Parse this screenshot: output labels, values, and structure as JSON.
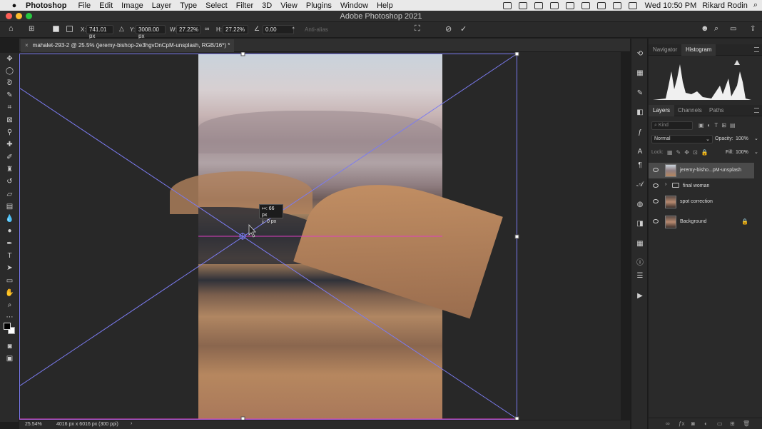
{
  "menubar": {
    "app_name": "Photoshop",
    "items": [
      "File",
      "Edit",
      "Image",
      "Layer",
      "Type",
      "Select",
      "Filter",
      "3D",
      "View",
      "Plugins",
      "Window",
      "Help"
    ],
    "clock": "Wed 10:50 PM",
    "user": "Rikard Rodin"
  },
  "window": {
    "title": "Adobe Photoshop 2021"
  },
  "options": {
    "x_label": "X:",
    "x_value": "741.01 px",
    "y_label": "Y:",
    "y_value": "3008.00 px",
    "w_label": "W:",
    "w_value": "27.22%",
    "h_label": "H:",
    "h_value": "27.22%",
    "angle_value": "0.00",
    "angle_unit": "°",
    "antialias": "Anti-alias"
  },
  "document": {
    "tab_title": "mahalet-293-2 @ 25.5% (jeremy-bishop-2e3hgvDnCpM-unsplash, RGB/16*) *"
  },
  "transform_readout": {
    "line1": "↦: 66 px",
    "line2": "⤓:   0 px"
  },
  "panels": {
    "top_tabs": [
      "Navigator",
      "Histogram"
    ],
    "layers_tabs": [
      "Layers",
      "Channels",
      "Paths"
    ],
    "kind_placeholder": "Kind",
    "blend_mode": "Normal",
    "opacity_label": "Opacity:",
    "opacity_value": "100%",
    "lock_label": "Lock:",
    "fill_label": "Fill:",
    "fill_value": "100%",
    "layers": [
      {
        "name": "jeremy-bisho...pM-unsplash",
        "selected": true
      },
      {
        "name": "final woman",
        "folder": true
      },
      {
        "name": "spot correction"
      },
      {
        "name": "Background",
        "locked": true
      }
    ]
  },
  "status": {
    "zoom": "25.54%",
    "doc_info": "4016 px x 6016 px (300 ppi)"
  },
  "colors": {
    "guide": "#7b7bf0",
    "smart_guide": "#e040c0",
    "photo_top": "#c9d3dc",
    "sand": "#b6875f"
  }
}
